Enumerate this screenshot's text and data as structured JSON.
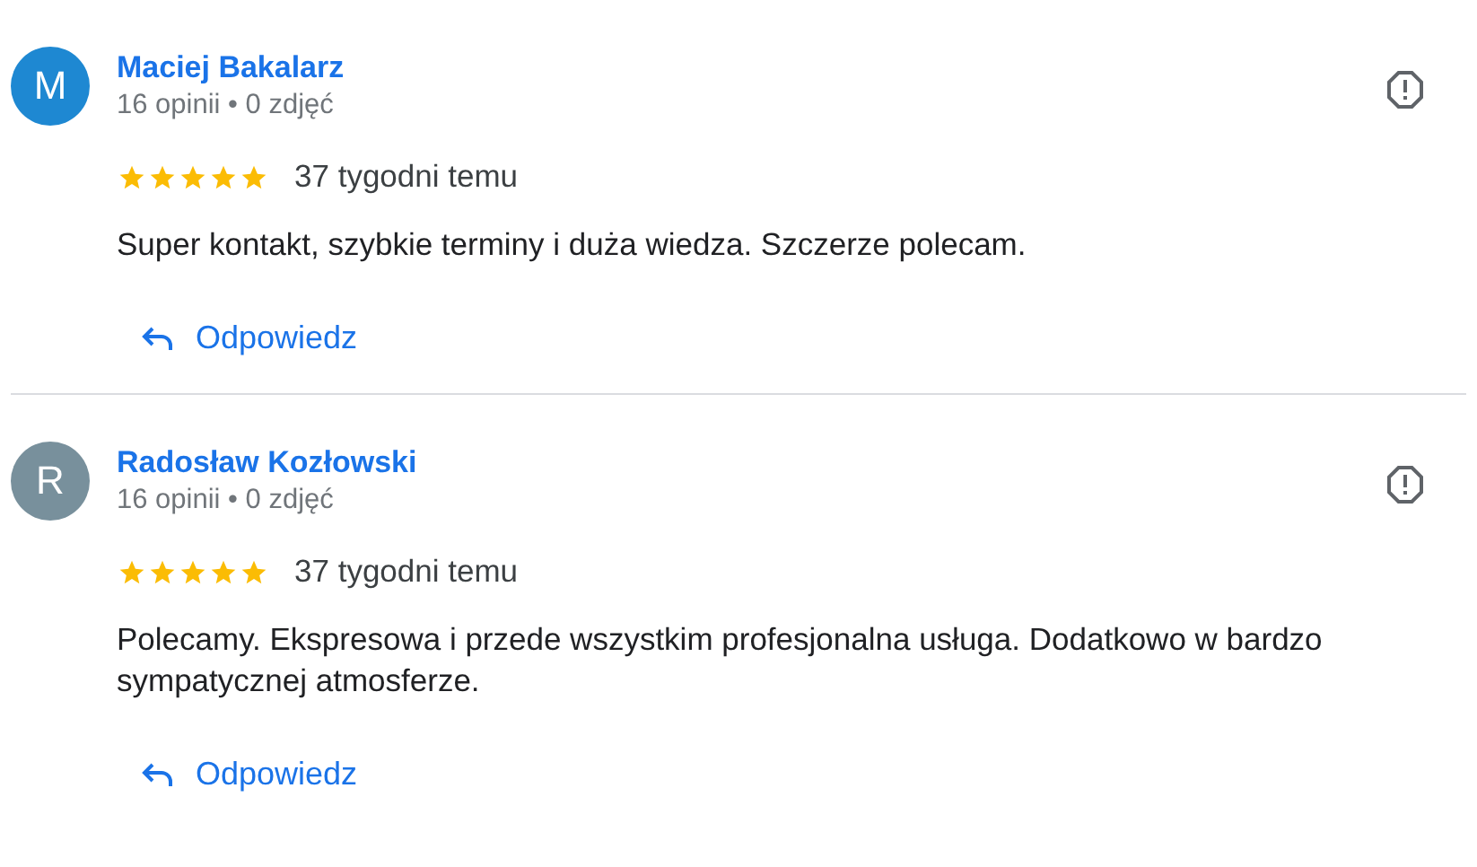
{
  "reviews": [
    {
      "initial": "M",
      "color": "#1e88d2",
      "name": "Maciej Bakalarz",
      "meta": "16 opinii • 0 zdjęć",
      "stars": 5,
      "time": "37 tygodni temu",
      "text": "Super kontakt, szybkie terminy i duża wiedza. Szczerze polecam.",
      "reply": "Odpowiedz"
    },
    {
      "initial": "R",
      "color": "#78909c",
      "name": "Radosław Kozłowski",
      "meta": "16 opinii • 0 zdjęć",
      "stars": 5,
      "time": "37 tygodni temu",
      "text": "Polecamy. Ekspresowa i przede wszystkim profesjonalna usługa. Dodatkowo w bardzo sympatycznej atmosferze.",
      "reply": "Odpowiedz"
    }
  ]
}
